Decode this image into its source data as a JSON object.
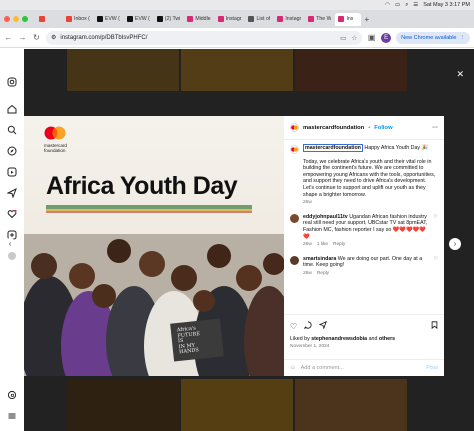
{
  "menubar": {
    "battery": "",
    "date_time": "Sat May 3  3:17 PM"
  },
  "tabs": [
    {
      "label": "",
      "color": "#ea4335"
    },
    {
      "label": "Inbox (",
      "color": "#ea4335"
    },
    {
      "label": "EVW (",
      "color": "#111111"
    },
    {
      "label": "EVW (",
      "color": "#111111"
    },
    {
      "label": "(2) Twi",
      "color": "#111111"
    },
    {
      "label": "Middle",
      "color": "#d62976"
    },
    {
      "label": "Instagr",
      "color": "#d62976"
    },
    {
      "label": "List of",
      "color": "#555555"
    },
    {
      "label": "Instagr",
      "color": "#d62976"
    },
    {
      "label": "The W",
      "color": "#d62976"
    },
    {
      "label": "Ins",
      "color": "#d62976"
    }
  ],
  "toolbar": {
    "url": "instagram.com/p/DBTbIsvPHFC/",
    "profile_initial": "E",
    "new_chrome": "New Chrome available"
  },
  "post": {
    "brand_line1": "mastercard",
    "brand_line2": "foundation",
    "headline": "Africa Youth Day",
    "sign_text": "Africa's\nFUTURE\nIS\nIN MY\nHANDS",
    "username": "mastercardfoundation",
    "follow": "Follow",
    "caption_tag": "mastercardfoundation",
    "caption_rest": " Happy Africa Youth Day 🎉",
    "caption_body": "Today, we celebrate Africa's youth and their vital role in building the continent's future. We are committed to empowering young Africans with the tools, opportunities, and support they need to drive Africa's development. Let's continue to support and uplift our youth as they shape a brighter tomorrow.",
    "caption_time": "26w",
    "comments": [
      {
        "user": "eddyjohnpaul11tv",
        "text": " Ugandan African fashion industry real still need your support, UBCstar TV sat 8pmEAT, Fashion MC, fashion reporter I say so ❤️❤️❤️❤️❤️❤️",
        "time": "26w",
        "likes": "1 like",
        "reply": "Reply"
      },
      {
        "user": "smartsindara",
        "text": " We are doing our part. One day at a time. Keep going!",
        "time": "26w",
        "likes": "",
        "reply": "Reply"
      }
    ],
    "liked_by_prefix": "Liked by ",
    "liked_by_user": "stephenandrewsdobia",
    "liked_by_suffix": " and ",
    "liked_by_others": "others",
    "date": "November 1, 2024",
    "add_comment_placeholder": "Add a comment...",
    "post_label": "Post"
  },
  "colors": {
    "instagram_blue": "#0095f6",
    "mc_red": "#eb001b",
    "mc_orange": "#f79e1b"
  }
}
